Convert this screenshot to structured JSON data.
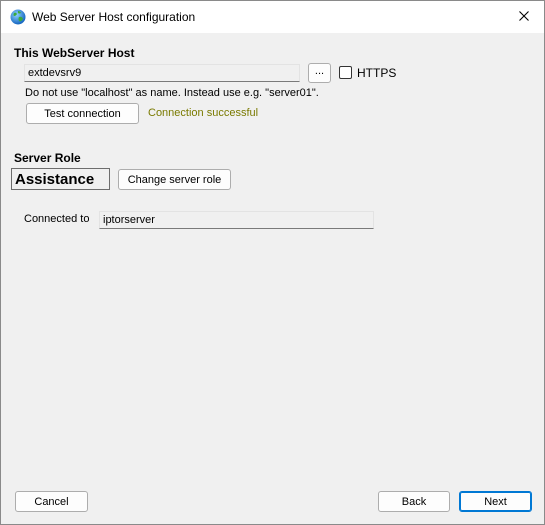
{
  "window": {
    "title": "Web Server Host configuration"
  },
  "host": {
    "section_title": "This WebServer Host",
    "hostname_value": "extdevsrv9",
    "browse_label": "...",
    "https_label": "HTTPS",
    "https_checked": false,
    "hint": "Do not use \"localhost\" as name. Instead use e.g. \"server01\".",
    "test_button": "Test connection",
    "status_text": "Connection successful",
    "status_color": "#7a7a00"
  },
  "role": {
    "section_title": "Server Role",
    "current_role": "Assistance",
    "change_button": "Change server role"
  },
  "connection": {
    "label": "Connected to",
    "value": "iptorserver"
  },
  "footer": {
    "cancel_label": "Cancel",
    "back_label": "Back",
    "next_label": "Next"
  },
  "colors": {
    "accent": "#0078d4",
    "window_bg": "#f0f0f0"
  }
}
